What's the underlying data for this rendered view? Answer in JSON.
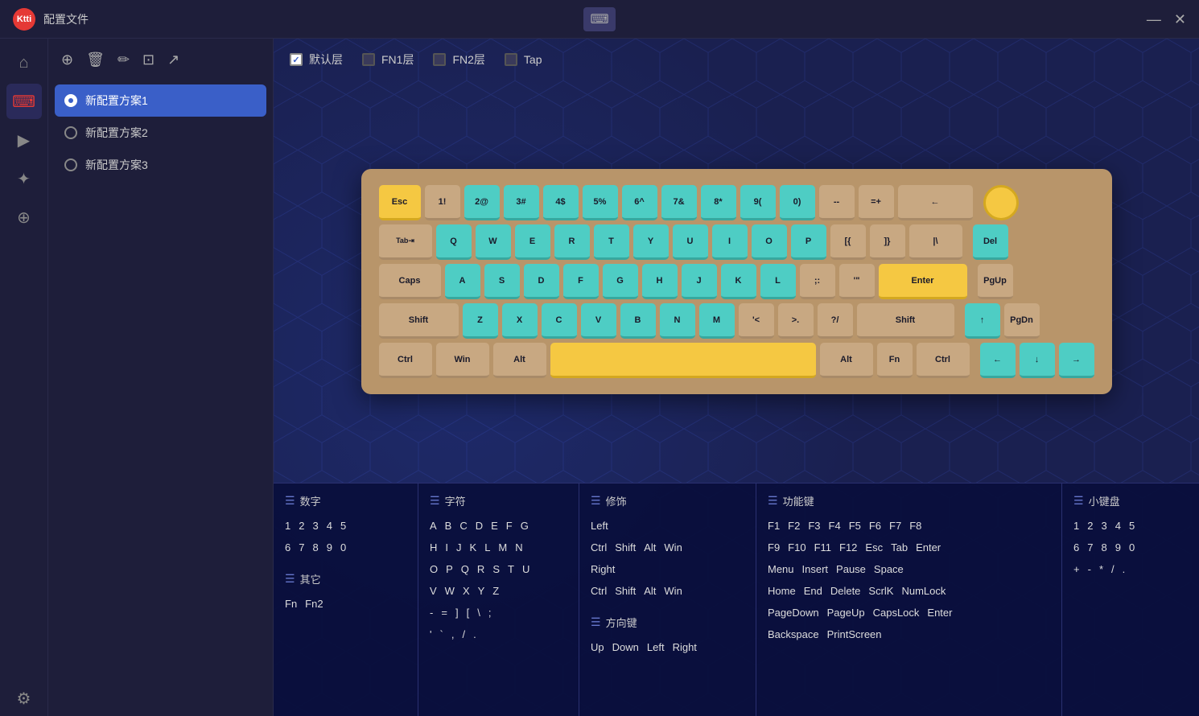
{
  "titlebar": {
    "logo": "Ktti",
    "title": "配置文件",
    "keyboard_icon": "⌨",
    "minimize": "—",
    "close": "✕"
  },
  "sidebar_icons": [
    {
      "name": "home",
      "icon": "⌂",
      "active": false
    },
    {
      "name": "keyboard",
      "icon": "⌨",
      "active": true
    },
    {
      "name": "terminal",
      "icon": "▶",
      "active": false
    },
    {
      "name": "lighting",
      "icon": "✦",
      "active": false
    },
    {
      "name": "macro",
      "icon": "⊕",
      "active": false
    }
  ],
  "sidebar_toolbar": {
    "add": "⊕",
    "delete": "🗑",
    "edit": "✏",
    "copy": "⊡",
    "export": "↗"
  },
  "profiles": [
    {
      "name": "新配置方案1",
      "active": true
    },
    {
      "name": "新配置方案2",
      "active": false
    },
    {
      "name": "新配置方案3",
      "active": false
    }
  ],
  "layers": [
    {
      "label": "默认层",
      "checked": true
    },
    {
      "label": "FN1层",
      "checked": false
    },
    {
      "label": "FN2层",
      "checked": false
    },
    {
      "label": "Tap",
      "checked": false
    }
  ],
  "keyboard": {
    "rows": [
      [
        "Esc",
        "1!",
        "2@",
        "3#",
        "4$",
        "5%",
        "6^",
        "7&",
        "8*",
        "9(",
        "0)",
        "--",
        "=+",
        "←"
      ],
      [
        "Tab⇥",
        "Q",
        "W",
        "E",
        "R",
        "T",
        "Y",
        "U",
        "I",
        "O",
        "P",
        "[{",
        "]}",
        "|\\"
      ],
      [
        "Caps",
        "A",
        "S",
        "D",
        "F",
        "G",
        "H",
        "J",
        "K",
        "L",
        ";:",
        "'\"",
        "Enter"
      ],
      [
        "Shift",
        "Z",
        "X",
        "C",
        "V",
        "B",
        "N",
        "M",
        "'<",
        ">.",
        "?/",
        "Shift"
      ],
      [
        "Ctrl",
        "Win",
        "Alt",
        "",
        "Alt",
        "Fn",
        "Ctrl",
        "←",
        "↓",
        "→"
      ]
    ],
    "right_keys": [
      "Del",
      "PgUp",
      "PgDn"
    ]
  },
  "bottom_sections": [
    {
      "id": "numbers",
      "header": "数字",
      "keys": [
        [
          "1",
          "2",
          "3",
          "4",
          "5"
        ],
        [
          "6",
          "7",
          "8",
          "9",
          "0"
        ]
      ]
    },
    {
      "id": "chars",
      "header": "字符",
      "keys": [
        [
          "A",
          "B",
          "C",
          "D",
          "E",
          "F",
          "G"
        ],
        [
          "H",
          "I",
          "J",
          "K",
          "L",
          "M",
          "N"
        ],
        [
          "O",
          "P",
          "Q",
          "R",
          "S",
          "T",
          "U"
        ],
        [
          "V",
          "W",
          "X",
          "Y",
          "Z"
        ],
        [
          "-",
          "=",
          "]",
          "[",
          "\\",
          ";"
        ],
        [
          "'",
          "`",
          ",",
          "/",
          "."
        ]
      ]
    },
    {
      "id": "modifiers",
      "header": "修饰",
      "keys": [
        [
          "Left"
        ],
        [
          "Ctrl",
          "Shift",
          "Alt",
          "Win"
        ],
        [
          "Right"
        ],
        [
          "Ctrl",
          "Shift",
          "Alt",
          "Win"
        ]
      ]
    },
    {
      "id": "function",
      "header": "功能键",
      "keys": [
        [
          "F1",
          "F2",
          "F3",
          "F4",
          "F5",
          "F6",
          "F7",
          "F8"
        ],
        [
          "F9",
          "F10",
          "F11",
          "F12",
          "Esc",
          "Tab",
          "Enter"
        ],
        [
          "Menu",
          "Insert",
          "Pause",
          "Space"
        ],
        [
          "Home",
          "End",
          "Delete",
          "ScrlK",
          "NumLock"
        ],
        [
          "PageDown",
          "PageUp",
          "CapsLock",
          "Enter"
        ],
        [
          "Backspace",
          "PrintScreen"
        ]
      ]
    },
    {
      "id": "numpad",
      "header": "小键盘",
      "keys": [
        [
          "1",
          "2",
          "3",
          "4",
          "5"
        ],
        [
          "6",
          "7",
          "8",
          "9",
          "0"
        ],
        [
          "+",
          "-",
          "*",
          "/",
          "."
        ]
      ]
    },
    {
      "id": "arrows",
      "header": "方向键",
      "keys": [
        [
          "Up",
          "Down",
          "Left",
          "Right"
        ]
      ]
    },
    {
      "id": "other",
      "header": "其它",
      "keys": [
        [
          "Fn",
          "Fn2"
        ]
      ]
    }
  ],
  "settings_icon": "⚙"
}
